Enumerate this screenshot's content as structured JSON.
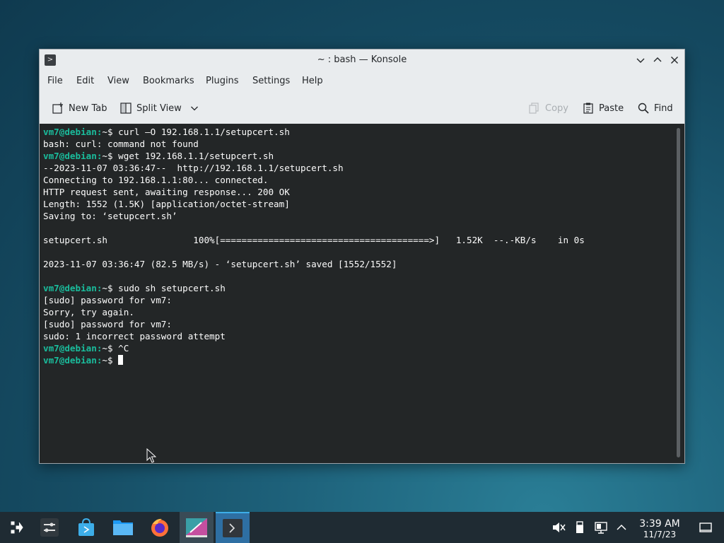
{
  "window": {
    "title": "~ : bash — Konsole",
    "controls": [
      "minimize",
      "maximize",
      "close"
    ]
  },
  "menubar": {
    "items": [
      "File",
      "Edit",
      "View",
      "Bookmarks",
      "Plugins",
      "Settings",
      "Help"
    ]
  },
  "toolbar": {
    "new_tab": "New Tab",
    "split_view": "Split View",
    "copy": "Copy",
    "paste": "Paste",
    "find": "Find"
  },
  "terminal": {
    "prompt": "vm7@debian:",
    "prompt_tail": "~$ ",
    "lines": [
      {
        "type": "cmd",
        "text": "curl –O 192.168.1.1/setupcert.sh"
      },
      {
        "type": "out",
        "text": "bash: curl: command not found"
      },
      {
        "type": "cmd",
        "text": "wget 192.168.1.1/setupcert.sh"
      },
      {
        "type": "out",
        "text": "--2023-11-07 03:36:47--  http://192.168.1.1/setupcert.sh"
      },
      {
        "type": "out",
        "text": "Connecting to 192.168.1.1:80... connected."
      },
      {
        "type": "out",
        "text": "HTTP request sent, awaiting response... 200 OK"
      },
      {
        "type": "out",
        "text": "Length: 1552 (1.5K) [application/octet-stream]"
      },
      {
        "type": "out",
        "text": "Saving to: ‘setupcert.sh’"
      },
      {
        "type": "out",
        "text": ""
      },
      {
        "type": "out",
        "text": "setupcert.sh                100%[=======================================>]   1.52K  --.-KB/s    in 0s"
      },
      {
        "type": "out",
        "text": ""
      },
      {
        "type": "out",
        "text": "2023-11-07 03:36:47 (82.5 MB/s) - ‘setupcert.sh’ saved [1552/1552]"
      },
      {
        "type": "out",
        "text": ""
      },
      {
        "type": "cmd",
        "text": "sudo sh setupcert.sh"
      },
      {
        "type": "out",
        "text": "[sudo] password for vm7:"
      },
      {
        "type": "out",
        "text": "Sorry, try again."
      },
      {
        "type": "out",
        "text": "[sudo] password for vm7:"
      },
      {
        "type": "out",
        "text": "sudo: 1 incorrect password attempt"
      },
      {
        "type": "cmd",
        "text": "^C"
      },
      {
        "type": "cmd",
        "text": "",
        "cursor": true
      }
    ]
  },
  "taskbar": {
    "apps": [
      "application-launcher-icon",
      "system-settings-icon",
      "discover-icon",
      "dolphin-file-manager-icon",
      "firefox-icon",
      "kate-editor-icon",
      "konsole-icon"
    ],
    "tray": [
      "volume-muted-icon",
      "removable-device-icon",
      "network-icon",
      "show-hidden-icon"
    ],
    "clock_time": "3:39 AM",
    "clock_date": "11/7/23"
  },
  "colors": {
    "terminal_bg": "#232627",
    "prompt": "#1abc9c",
    "accent": "#3daee9"
  }
}
